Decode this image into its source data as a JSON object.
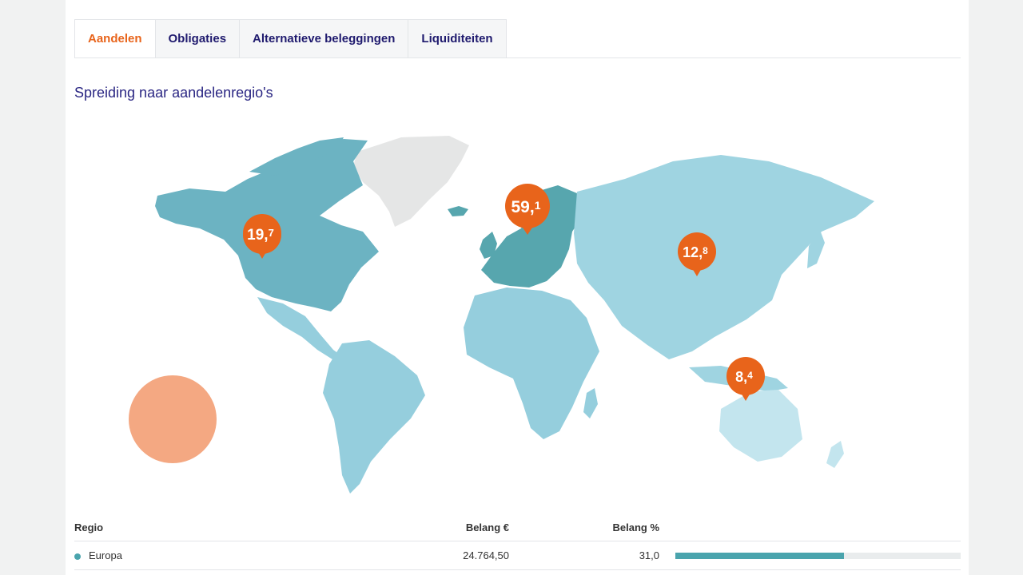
{
  "tabs": [
    {
      "label": "Aandelen",
      "active": true
    },
    {
      "label": "Obligaties",
      "active": false
    },
    {
      "label": "Alternatieve beleggingen",
      "active": false
    },
    {
      "label": "Liquiditeiten",
      "active": false
    }
  ],
  "section_title": "Spreiding naar aandelenregio's",
  "map_markers": {
    "north_america": {
      "whole": "19,",
      "decimal": "7"
    },
    "europe": {
      "whole": "59,",
      "decimal": "1"
    },
    "asia": {
      "whole": "12,",
      "decimal": "8"
    },
    "oceania": {
      "whole": "8,",
      "decimal": "4"
    }
  },
  "colors": {
    "accent": "#e8641b",
    "navy": "#1f1a6e",
    "europe": "#57a6ae",
    "north_america": "#6cb3c2",
    "asia": "#9fd4e1",
    "latin_america": "#95cedd",
    "africa": "#95cedd",
    "oceania": "#c3e5ee",
    "greenland": "#e5e6e6",
    "bar": "#4aa4ad"
  },
  "table": {
    "headers": {
      "regio": "Regio",
      "belang_eur": "Belang €",
      "belang_pct": "Belang %"
    },
    "rows": [
      {
        "regio": "Europa",
        "belang_eur": "24.764,50",
        "belang_pct": "31,0",
        "fraction": 0.59
      }
    ]
  }
}
